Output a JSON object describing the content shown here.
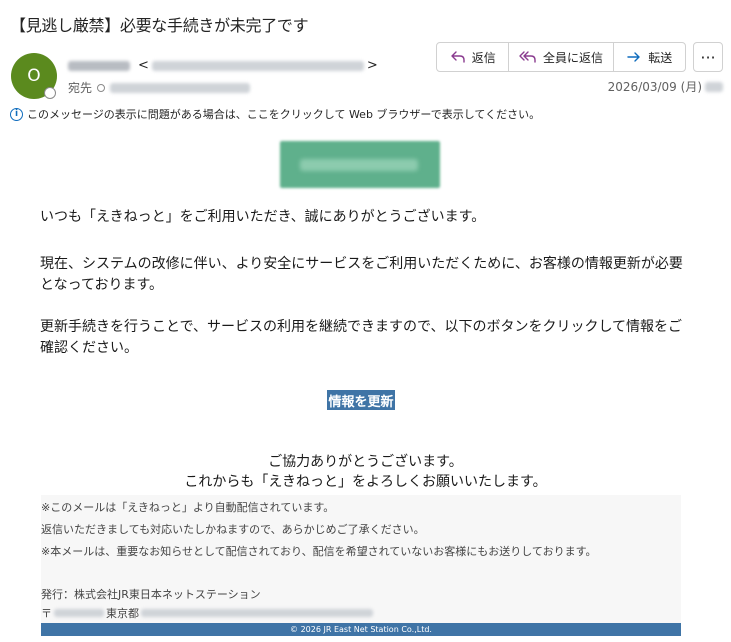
{
  "email": {
    "subject": "【見逃し厳禁】必要な手続きが未完了です",
    "avatar_initial": "O",
    "sender_bracket_open": "<",
    "sender_bracket_close": ">",
    "to_label": "宛先",
    "date": "2026/03/09 (月)"
  },
  "actions": {
    "reply": "返信",
    "reply_all": "全員に返信",
    "forward": "転送",
    "more": "···"
  },
  "infobar": {
    "text": "このメッセージの表示に問題がある場合は、ここをクリックして Web ブラウザーで表示してください。"
  },
  "body": {
    "greeting": "いつも「えきねっと」をご利用いただき、誠にありがとうございます。",
    "para1": "現在、システムの改修に伴い、より安全にサービスをご利用いただくために、お客様の情報更新が必要となっております。",
    "para2": "更新手続きを行うことで、サービスの利用を継続できますので、以下のボタンをクリックして情報をご確認ください。",
    "cta": "情報を更新",
    "thanks1": "ご協力ありがとうございます。",
    "thanks2": "これからも「えきねっと」をよろしくお願いいたします。"
  },
  "footer": {
    "line1": "※このメールは「えきねっと」より自動配信されています。",
    "line2": "返信いただきましても対応いたしかねますので、あらかじめご了承ください。",
    "line3": "※本メールは、重要なお知らせとして配信されており、配信を希望されていないお客様にもお送りしております。",
    "issuer": "発行：株式会社JR東日本ネットステーション",
    "postal_mark": "〒",
    "prefecture": "東京都",
    "copyright": "© 2026 JR East Net Station Co.,Ltd."
  },
  "colors": {
    "avatar": "#5b8a1e",
    "button": "#3f74a6",
    "link_icon": "#0f6cbd"
  }
}
